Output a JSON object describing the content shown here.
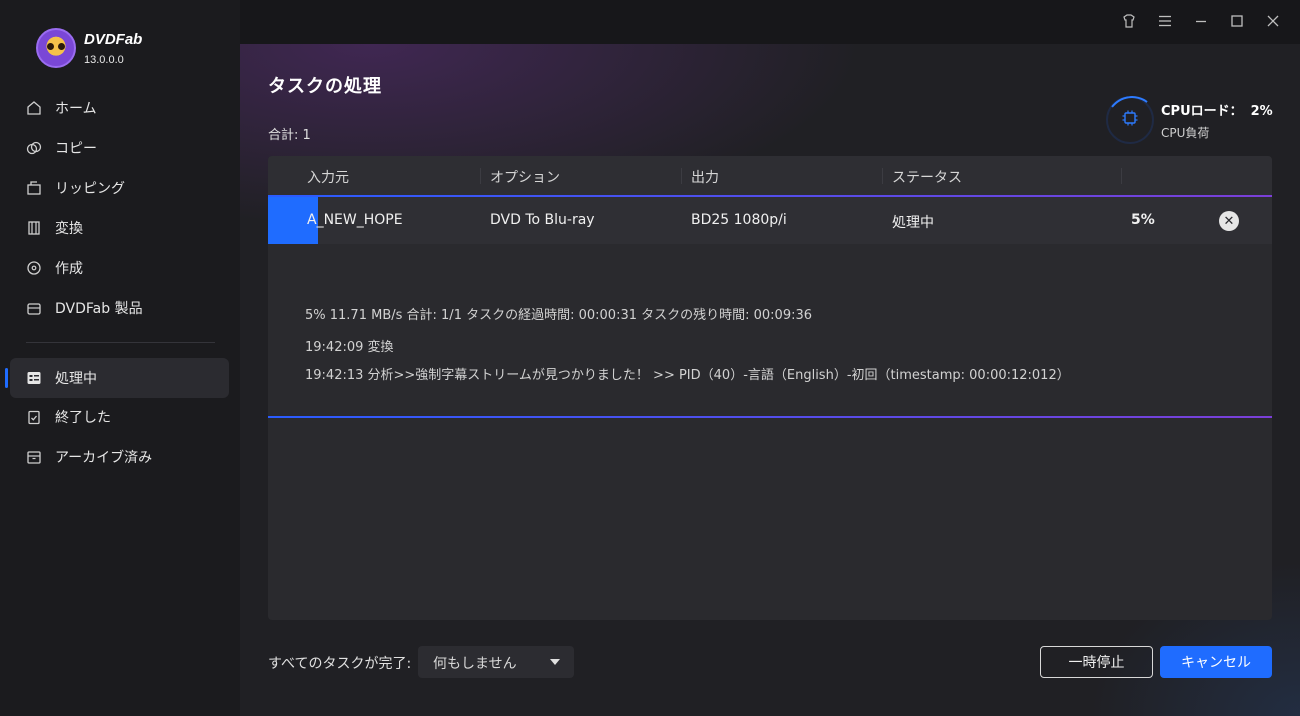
{
  "brand": {
    "name": "DVDFab",
    "version": "13.0.0.0"
  },
  "sidebar": {
    "items": [
      {
        "label": "ホーム",
        "icon": "home-icon"
      },
      {
        "label": "コピー",
        "icon": "copy-icon"
      },
      {
        "label": "リッピング",
        "icon": "ripper-icon"
      },
      {
        "label": "変換",
        "icon": "film-icon"
      },
      {
        "label": "作成",
        "icon": "disc-icon"
      },
      {
        "label": "DVDFab 製品",
        "icon": "box-icon"
      },
      {
        "label": "処理中",
        "icon": "task-list-icon",
        "active": true
      },
      {
        "label": "終了した",
        "icon": "clipboard-check-icon"
      },
      {
        "label": "アーカイブ済み",
        "icon": "archive-icon"
      }
    ]
  },
  "main": {
    "title": "タスクの処理",
    "total": "合計: 1",
    "cpu": {
      "label": "CPUロード：",
      "value": "2%",
      "sub": "CPU負荷",
      "percent": 2
    },
    "table": {
      "headers": [
        "入力元",
        "オプション",
        "出力",
        "ステータス"
      ],
      "row": {
        "source": "A_NEW_HOPE",
        "option": "DVD To Blu-ray",
        "output": "BD25 1080p/i",
        "status": "処理中",
        "progress": "5%",
        "progress_value": 5
      },
      "log": [
        "5%  11.71 MB/s   合計: 1/1  タスクの経過時間: 00:00:31  タスクの残り時間: 00:09:36",
        "19:42:09  変換",
        "19:42:13  分析>>強制字幕ストリームが見つかりました！  >> PID（40）-言語（English）-初回（timestamp: 00:00:12:012）"
      ]
    },
    "footer": {
      "label": "すべてのタスクが完了:",
      "select_value": "何もしません",
      "pause_button": "一時停止",
      "cancel_button": "キャンセル"
    }
  },
  "colors": {
    "accent": "#1f6cff",
    "purple": "#7b3fd8"
  }
}
